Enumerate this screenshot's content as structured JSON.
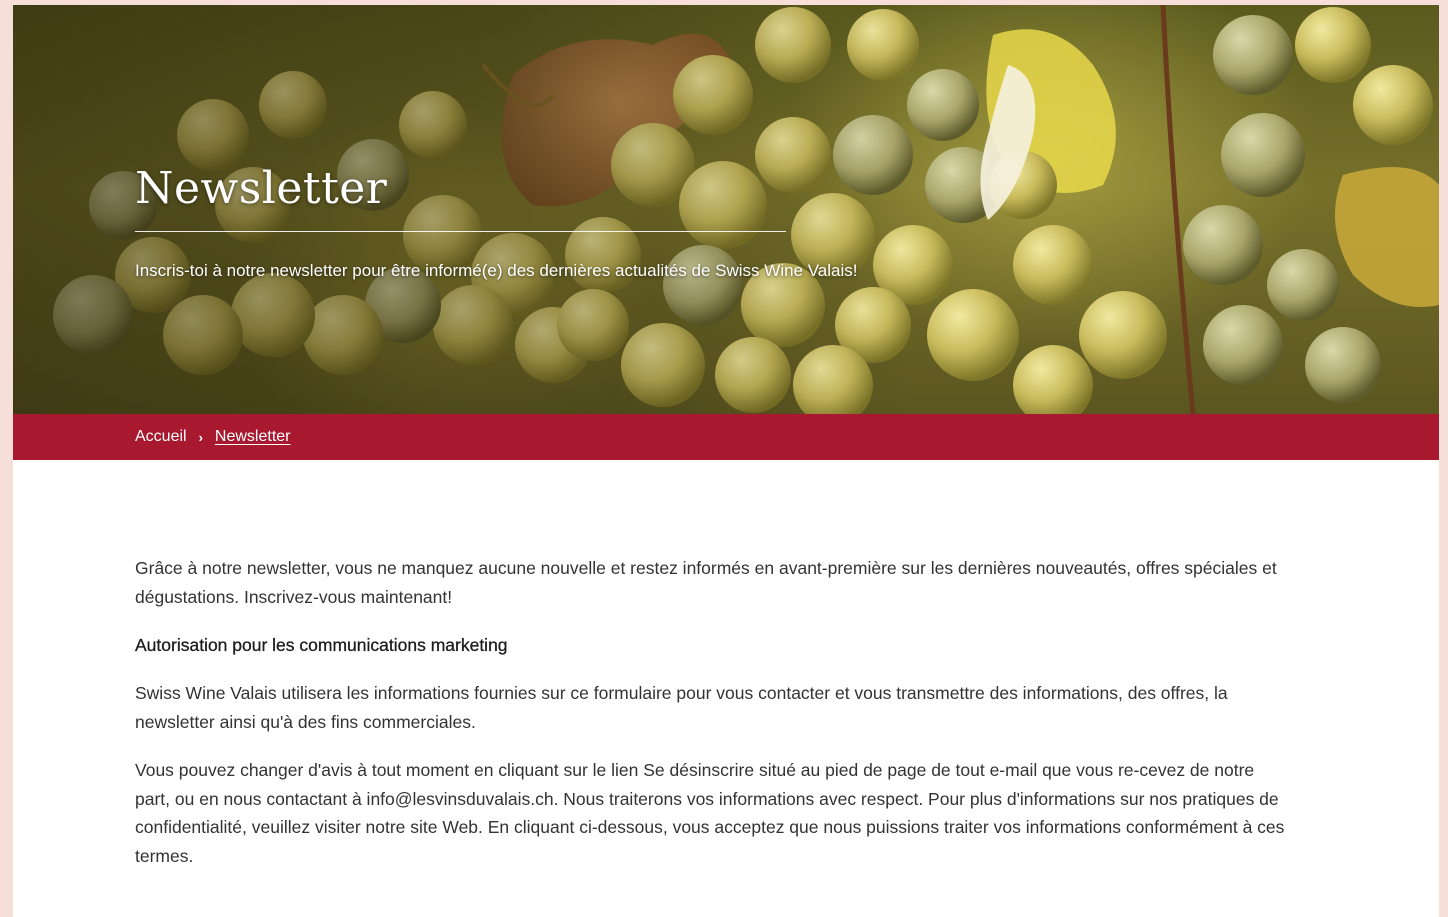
{
  "hero": {
    "title": "Newsletter",
    "subtitle": "Inscris-toi à notre newsletter pour être informé(e) des dernières actualités de Swiss Wine Valais!"
  },
  "breadcrumb": {
    "home": "Accueil",
    "separator": "›",
    "current": "Newsletter"
  },
  "content": {
    "intro": "Grâce à notre newsletter, vous ne manquez aucune nouvelle et restez informés en avant-première sur les dernières nouveautés, offres spéciales et dégustations. Inscrivez-vous maintenant!",
    "consent_heading": "Autorisation pour les communications marketing",
    "consent_text": "Swiss Wine Valais utilisera les informations fournies sur ce formulaire pour vous contacter et vous transmettre des informations, des offres, la newsletter ainsi qu'à des fins commerciales.",
    "privacy_text": "Vous pouvez changer d'avis à tout moment en cliquant sur le lien Se désinscrire situé au pied de page de tout e-mail que vous re-cevez de notre part, ou en nous contactant à info@lesvinsduvalais.ch. Nous traiterons vos informations avec respect. Pour plus d'informations sur nos pratiques de confidentialité, veuillez visiter notre site Web. En cliquant ci-dessous, vous acceptez que nous puissions traiter vos informations conformément à ces termes."
  },
  "colors": {
    "brand_red": "#a8182f",
    "page_background": "#f6dfd8",
    "body_text": "#333333"
  }
}
